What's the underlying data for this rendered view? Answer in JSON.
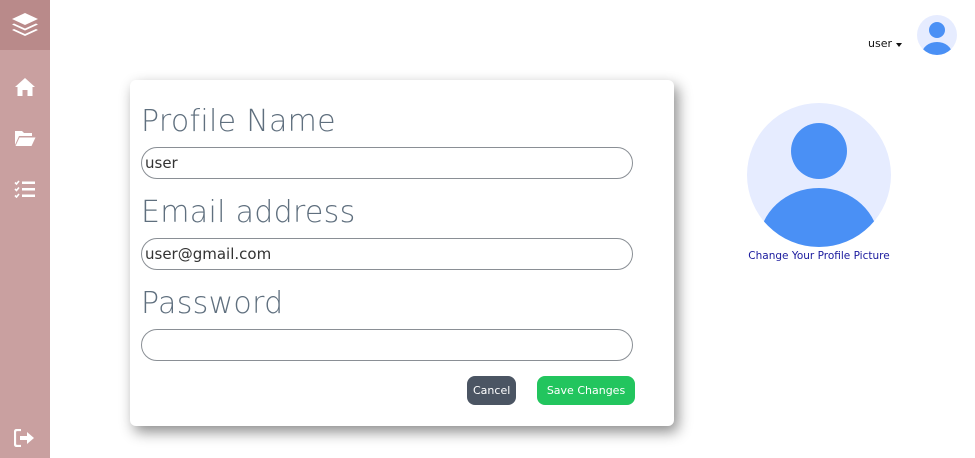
{
  "sidebar": {
    "icons": [
      "layers-icon",
      "home-icon",
      "folder-open-icon",
      "tasks-list-icon",
      "logout-icon"
    ],
    "color": "#c9a0a0",
    "logo_color": "#b98a8a"
  },
  "header": {
    "username": "user",
    "avatar_icon": "user-avatar-icon"
  },
  "form": {
    "profile_name_label": "Profile Name",
    "profile_name_value": "user",
    "email_label": "Email address",
    "email_value": "user@gmail.com",
    "password_label": "Password",
    "password_value": "",
    "cancel_label": "Cancel",
    "save_label": "Save Changes"
  },
  "profile_picture": {
    "change_label": "Change Your Profile Picture",
    "avatar_color": "#4a90f5",
    "background_color": "#e6ecff"
  },
  "colors": {
    "cancel": "#4b5563",
    "save": "#22c55e",
    "label": "#5f6f7e"
  }
}
